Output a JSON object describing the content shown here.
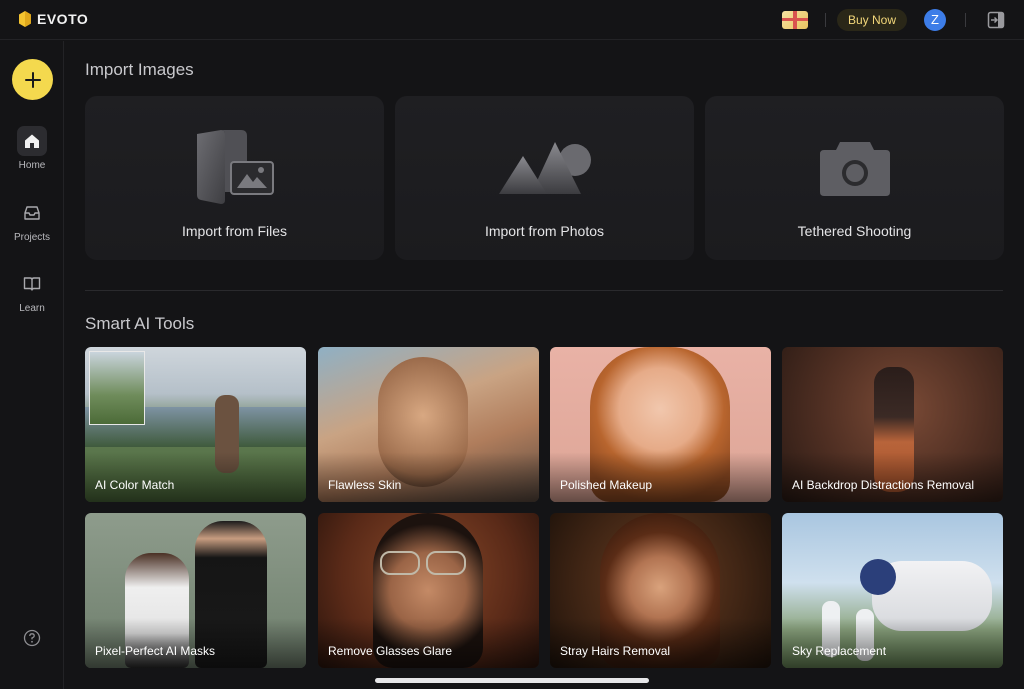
{
  "app": {
    "name": "EVOTO"
  },
  "topbar": {
    "buy_label": "Buy Now",
    "avatar_letter": "Z"
  },
  "sidebar": {
    "items": [
      {
        "label": "Home",
        "icon": "home-icon",
        "active": true
      },
      {
        "label": "Projects",
        "icon": "inbox-icon",
        "active": false
      },
      {
        "label": "Learn",
        "icon": "book-icon",
        "active": false
      }
    ]
  },
  "import": {
    "title": "Import Images",
    "cards": [
      {
        "label": "Import from Files",
        "icon": "files-icon"
      },
      {
        "label": "Import from Photos",
        "icon": "photos-icon"
      },
      {
        "label": "Tethered Shooting",
        "icon": "camera-icon"
      }
    ]
  },
  "tools": {
    "title": "Smart AI Tools",
    "items": [
      {
        "label": "AI Color Match"
      },
      {
        "label": "Flawless Skin"
      },
      {
        "label": "Polished Makeup"
      },
      {
        "label": "AI Backdrop Distractions Removal"
      },
      {
        "label": "Pixel-Perfect AI Masks"
      },
      {
        "label": "Remove Glasses Glare"
      },
      {
        "label": "Stray Hairs Removal"
      },
      {
        "label": "Sky Replacement"
      }
    ]
  },
  "colors": {
    "accent": "#f4d94e",
    "avatar": "#3d7de8",
    "background": "#141416"
  }
}
